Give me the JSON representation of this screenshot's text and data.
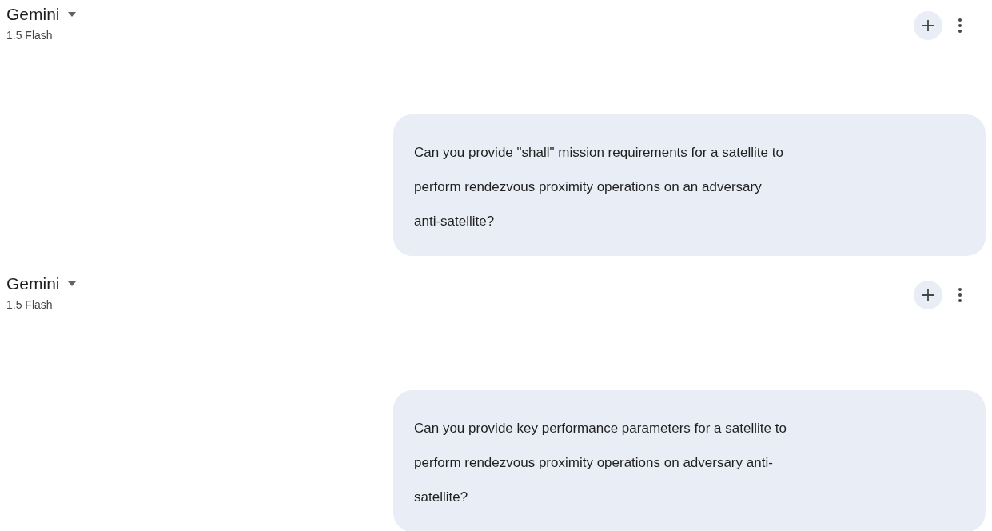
{
  "turns": [
    {
      "model": {
        "name": "Gemini",
        "version": "1.5 Flash"
      },
      "prompt_lines": [
        "Can you provide \"shall\" mission requirements for a satellite to",
        "perform rendezvous proximity operations on an adversary",
        "anti-satellite?"
      ]
    },
    {
      "model": {
        "name": "Gemini",
        "version": "1.5 Flash"
      },
      "prompt_lines": [
        "Can you provide key performance parameters for a satellite to",
        "perform rendezvous proximity operations on adversary anti-",
        "satellite?"
      ]
    }
  ]
}
